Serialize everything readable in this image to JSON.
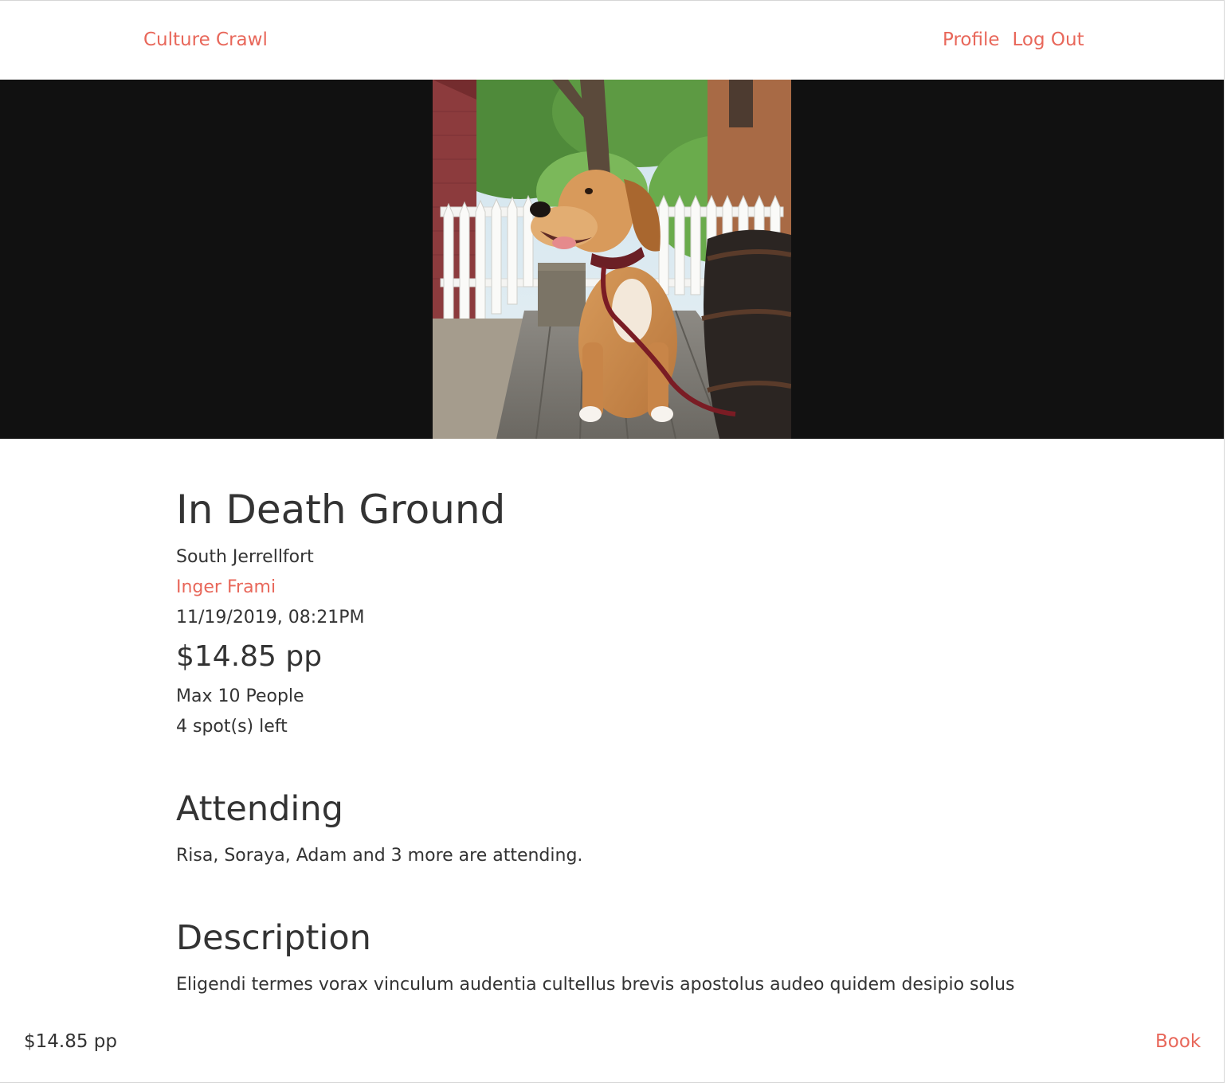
{
  "nav": {
    "brand": "Culture Crawl",
    "links": [
      "Profile",
      "Log Out"
    ]
  },
  "hero": {
    "image_icon": "dog-photo"
  },
  "event": {
    "title": "In Death Ground",
    "location": "South Jerrellfort",
    "host": "Inger Frami",
    "datetime": "11/19/2019, 08:21PM",
    "price": "$14.85 pp",
    "capacity": "Max 10 People",
    "spots_left": "4 spot(s) left"
  },
  "attending": {
    "heading": "Attending",
    "text": "Risa, Soraya, Adam and 3 more are attending."
  },
  "description": {
    "heading": "Description",
    "text": "Eligendi termes vorax vinculum audentia cultellus brevis apostolus audeo quidem desipio solus"
  },
  "footer": {
    "price": "$14.85 pp",
    "book_label": "Book"
  },
  "colors": {
    "accent": "#e8675a",
    "hero_bg": "#111111",
    "text": "#333333"
  }
}
